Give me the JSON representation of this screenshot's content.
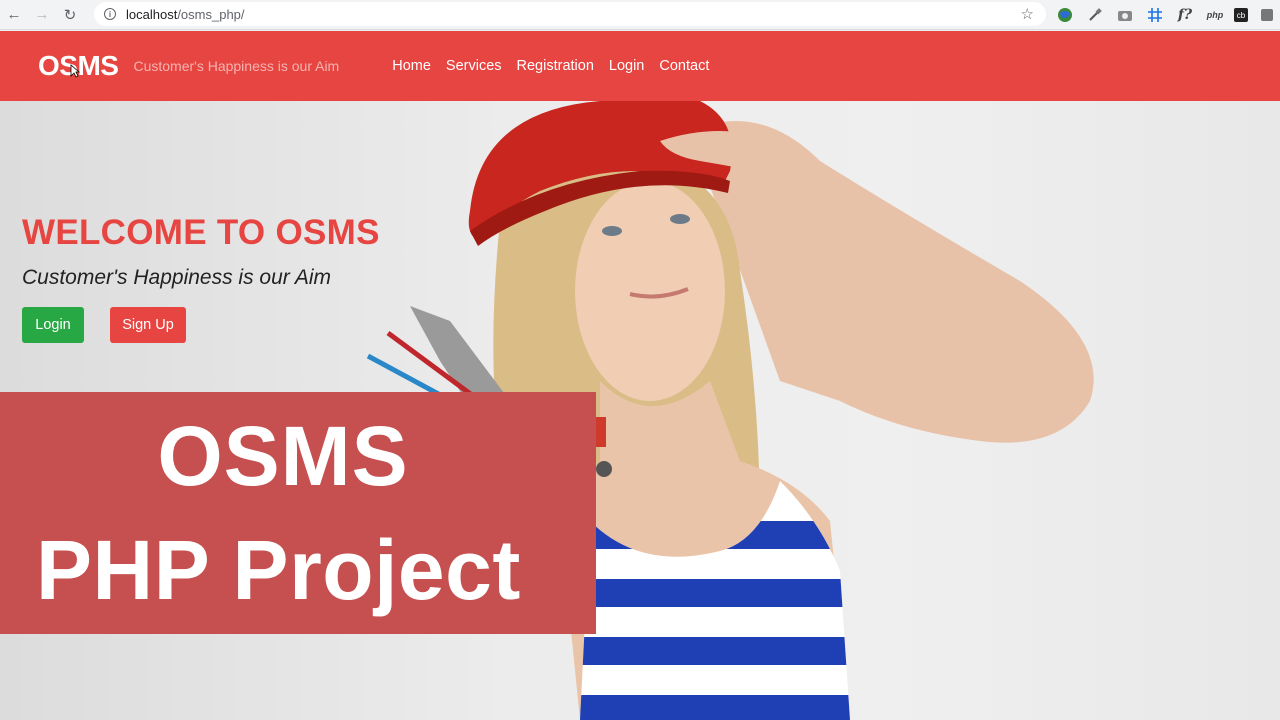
{
  "browser": {
    "url_host": "localhost",
    "url_path": "/osms_php/"
  },
  "icons": {
    "back": "arrow-left-icon",
    "forward": "arrow-right-icon",
    "reload": "reload-icon",
    "info": "info-icon",
    "bookmark": "star-icon",
    "ext_php": "php",
    "ext_cb": "cb"
  },
  "navbar": {
    "brand": "OSMS",
    "tagline": "Customer's Happiness is our Aim",
    "menu": [
      "Home",
      "Services",
      "Registration",
      "Login",
      "Contact"
    ]
  },
  "hero": {
    "title": "WELCOME TO OSMS",
    "subtitle": "Customer's Happiness is our Aim",
    "login_button": "Login",
    "signup_button": "Sign Up"
  },
  "banner": {
    "line1": "OSMS",
    "line2": "PHP Project"
  },
  "colors": {
    "brand_red": "#e74541",
    "success_green": "#28a745",
    "banner_red": "#c64f4f"
  }
}
